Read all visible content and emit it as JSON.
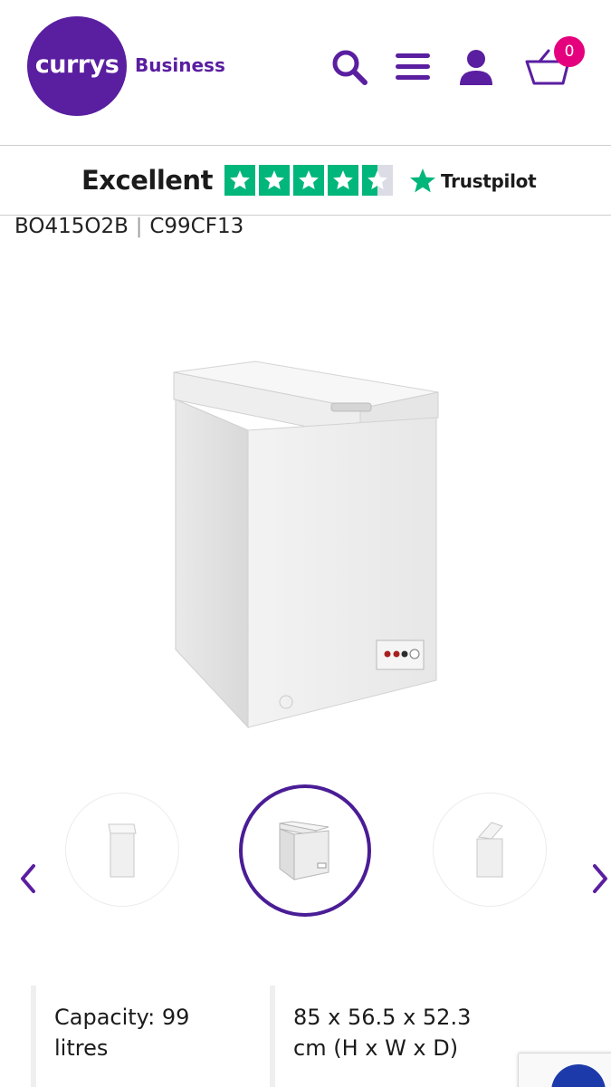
{
  "header": {
    "logo_text": "currys",
    "logo_sub": "Business",
    "cart_count": "0",
    "brand_color": "#5a1ea0",
    "badge_color": "#e5007d",
    "icons": [
      "search-icon",
      "menu-icon",
      "account-icon",
      "basket-icon"
    ]
  },
  "trustpilot": {
    "rating_label": "Excellent",
    "stars": 4.5,
    "brand": "Trustpilot",
    "star_color": "#00b67a"
  },
  "product": {
    "code_1": "BO415O2B",
    "code_2": "C99CF13"
  },
  "gallery": {
    "thumbnail_count": 3,
    "active_index": 1,
    "active_color": "#4a1d96"
  },
  "specs": [
    {
      "line1": "Capacity: 99",
      "line2": "litres"
    },
    {
      "line1": "85 x 56.5 x 52.3",
      "line2": "cm (H x W x D)"
    }
  ]
}
